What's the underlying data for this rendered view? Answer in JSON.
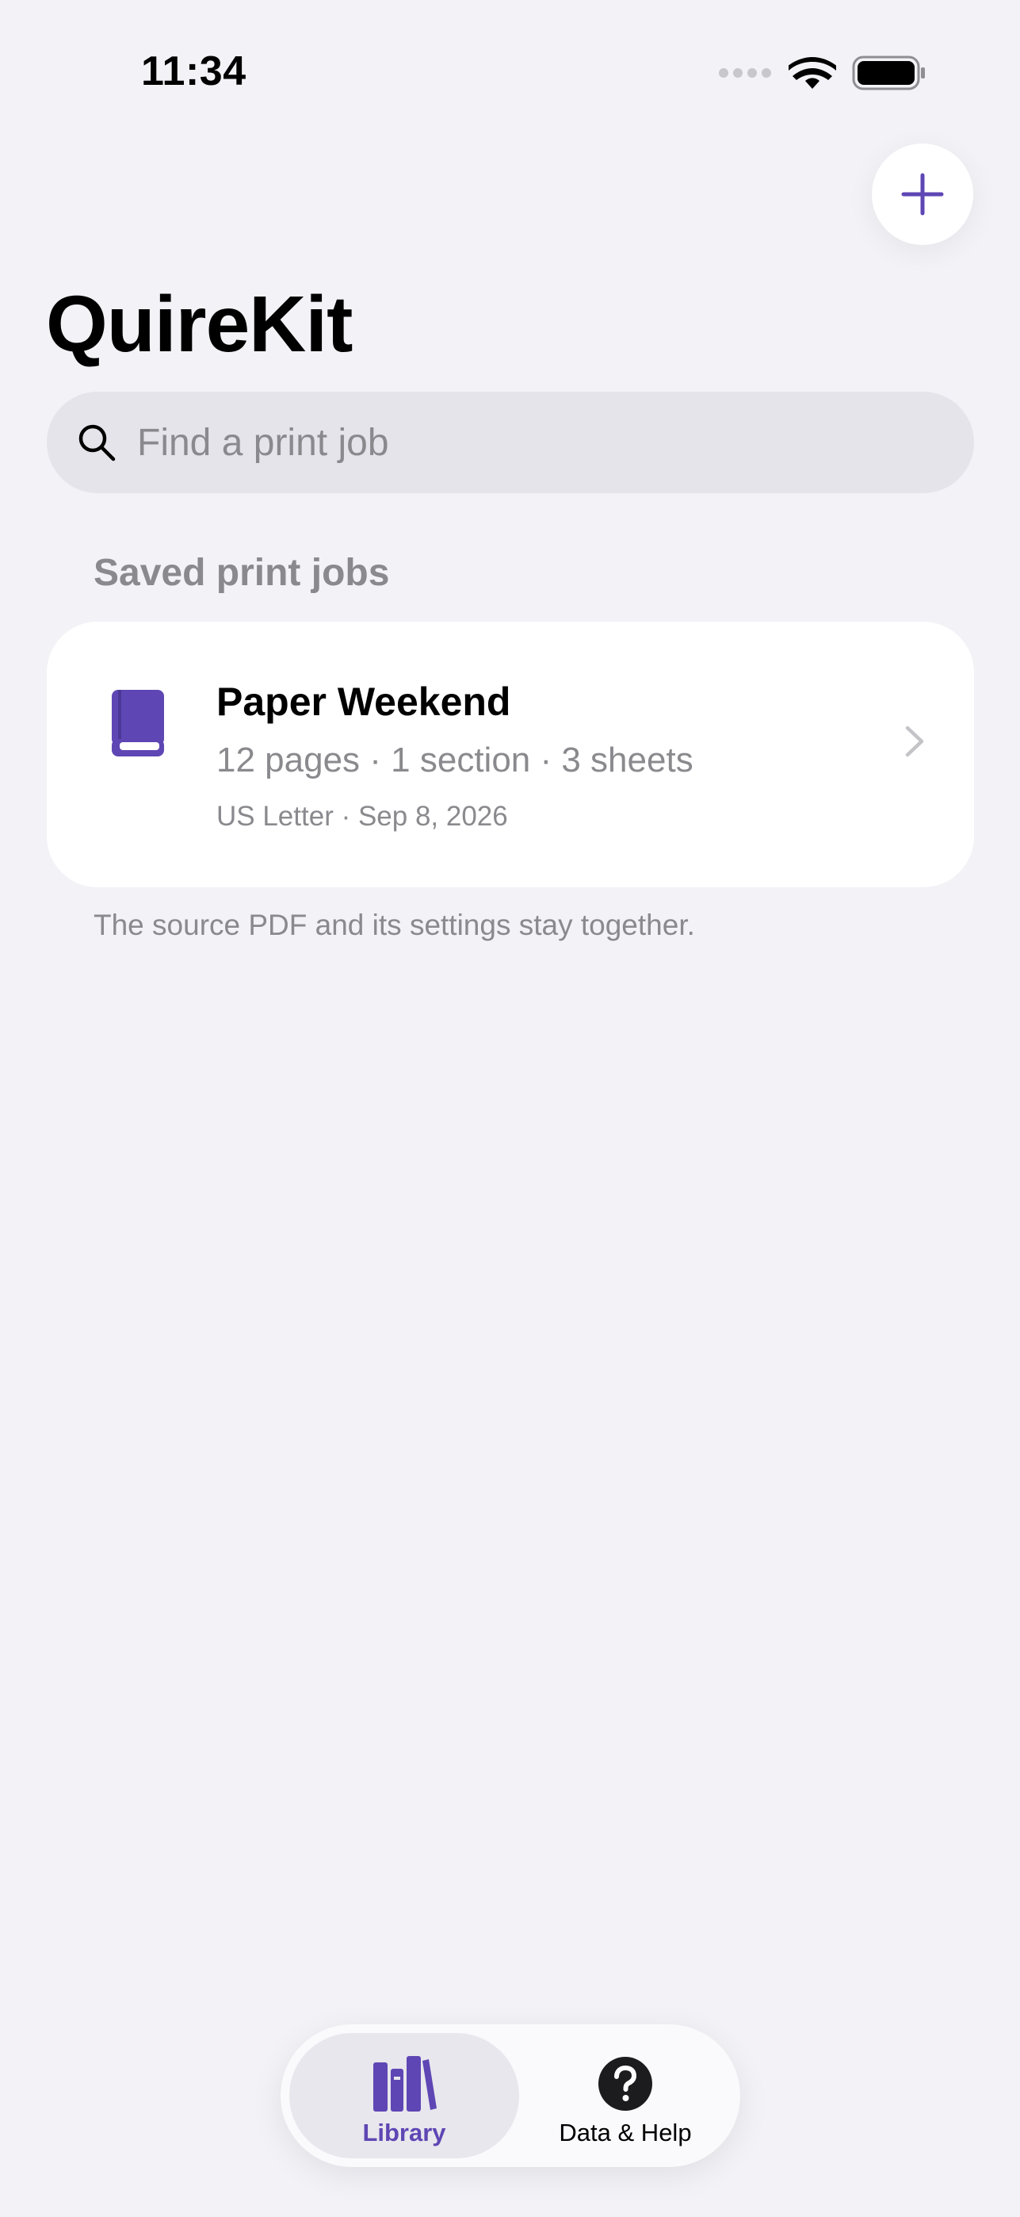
{
  "status_bar": {
    "time": "11:34"
  },
  "header": {
    "title": "QuireKit",
    "add_icon": "plus-icon"
  },
  "search": {
    "placeholder": "Find a print job",
    "value": "",
    "icon": "search-icon"
  },
  "library": {
    "section_title": "Saved print jobs",
    "jobs": [
      {
        "icon": "book-icon",
        "name": "Paper Weekend",
        "details": "12 pages · 1 section · 3 sheets",
        "meta": "US Letter · Sep 8, 2026"
      }
    ],
    "footer_note": "The source PDF and its settings stay together."
  },
  "tab_bar": {
    "tabs": [
      {
        "label": "Library",
        "icon": "books-icon",
        "selected": true
      },
      {
        "label": "Data & Help",
        "icon": "question-mark-icon",
        "selected": false
      }
    ]
  },
  "colors": {
    "accent": "#5e46b4",
    "background": "#f2f2f7",
    "secondary_text": "#8a8a8e"
  }
}
